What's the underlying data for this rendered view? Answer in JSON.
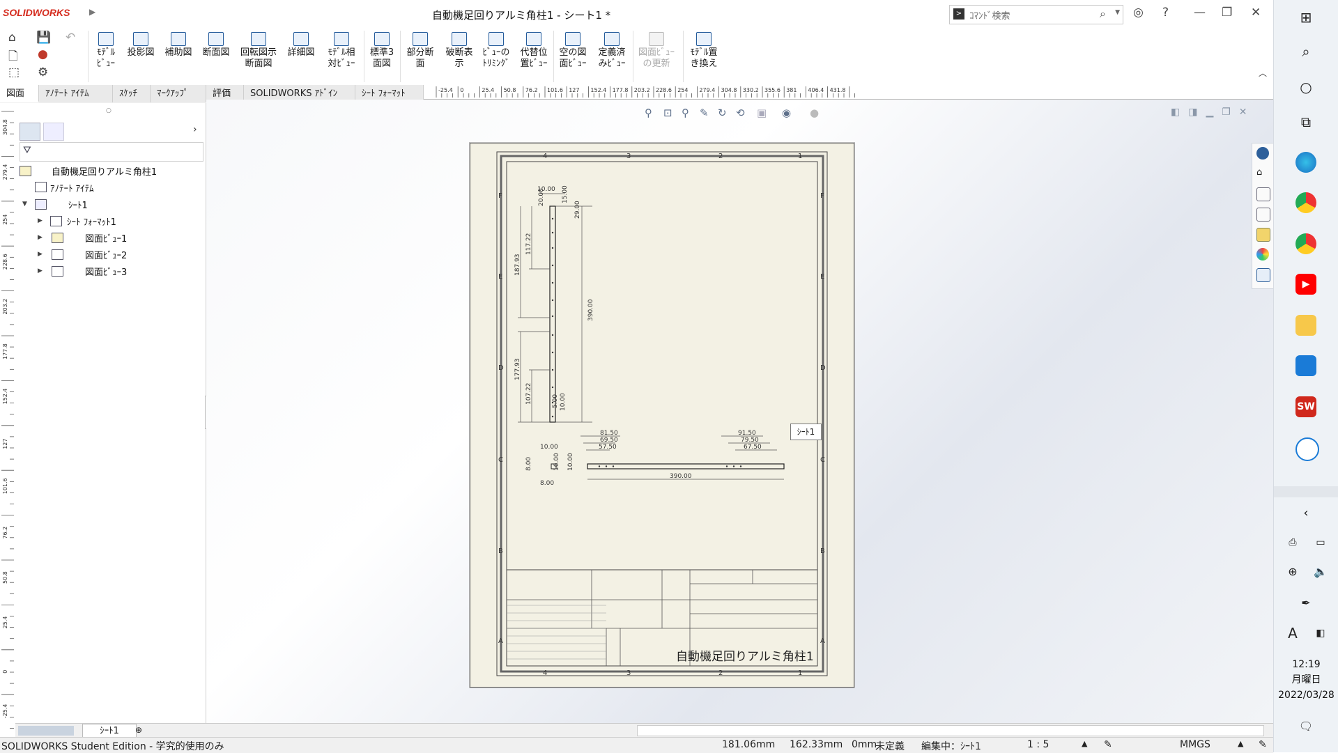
{
  "app": {
    "brand": "SOLIDWORKS",
    "window_title": "自動機足回りアルミ角柱1 - シート1 *"
  },
  "search": {
    "placeholder": "ｺﾏﾝﾄﾞ検索"
  },
  "ribbon": {
    "buttons": [
      "ﾓﾃﾞﾙ\nﾋﾞｭｰ",
      "投影図",
      "補助図",
      "断面図",
      "回転図示\n断面図",
      "詳細図",
      "ﾓﾃﾞﾙ相\n対ﾋﾞｭｰ",
      "標準3\n面図",
      "部分断\n面",
      "破断表\n示",
      "ﾋﾞｭｰの\nﾄﾘﾐﾝｸﾞ",
      "代替位\n置ﾋﾞｭｰ",
      "空の図\n面ﾋﾞｭｰ",
      "定義済\nみﾋﾞｭｰ",
      "図面ﾋﾞｭｰ\nの更新",
      "ﾓﾃﾞﾙ置\nき換え"
    ]
  },
  "tabs": [
    "図面",
    "ｱﾉﾃｰﾄ ｱｲﾃﾑ",
    "ｽｹｯﾁ",
    "ﾏｰｸｱｯﾌﾟ",
    "評価",
    "SOLIDWORKS ｱﾄﾞｲﾝ",
    "ｼｰﾄ ﾌｫｰﾏｯﾄ"
  ],
  "ruler_top": [
    "-25.4",
    "0",
    "25.4",
    "50.8",
    "76.2",
    "101.6",
    "127",
    "152.4",
    "177.8",
    "203.2",
    "228.6",
    "254",
    "279.4",
    "304.8",
    "330.2",
    "355.6",
    "381",
    "406.4",
    "431.8"
  ],
  "ruler_left": [
    "304.8",
    "279.4",
    "254",
    "228.6",
    "203.2",
    "177.8",
    "152.4",
    "127",
    "101.6",
    "76.2",
    "50.8",
    "25.4",
    "0",
    "-25.4"
  ],
  "tree": {
    "root": "自動機足回りアルミ角柱1",
    "annotations": "ｱﾉﾃｰﾄ ｱｲﾃﾑ",
    "sheet": "ｼｰﾄ1",
    "children": [
      "ｼｰﾄ ﾌｫｰﾏｯﾄ1",
      "図面ﾋﾞｭｰ1",
      "図面ﾋﾞｭｰ2",
      "図面ﾋﾞｭｰ3"
    ]
  },
  "drawing": {
    "zones_top": [
      "4",
      "3",
      "2",
      "1"
    ],
    "zones_side": [
      "F",
      "E",
      "D",
      "C",
      "B",
      "A"
    ],
    "dims": {
      "v_left": [
        "10.00",
        "20.00",
        "15.00",
        "29.00",
        "117.22",
        "187.93",
        "390.00",
        "177.93",
        "107.22",
        "5.00",
        "10.00"
      ],
      "h_top": [
        "81.50",
        "69.50",
        "57.50",
        "91.50",
        "79.50",
        "67.50"
      ],
      "small": [
        "10.00",
        "8.00",
        "10.00",
        "10.00",
        "8.00"
      ],
      "length": "390.00"
    },
    "title_block_name": "自動機足回りアルミ角柱1",
    "tooltip": "ｼｰﾄ1"
  },
  "sheet_tab": "ｼｰﾄ1",
  "status": {
    "edition": "SOLIDWORKS Student Edition - 学究的使用のみ",
    "x": "181.06mm",
    "y": "162.33mm",
    "z": "0mm",
    "defined": "未定義",
    "editing": "編集中：ｼｰﾄ1",
    "scale": "1 : 5",
    "units": "MMGS"
  },
  "taskbar": {
    "time": "12:19",
    "weekday": "月曜日",
    "date": "2022/03/28",
    "ime": "A"
  },
  "colors": {
    "brand_red": "#d52b1e",
    "sheet_paper": "#f3f1e4",
    "accent_blue": "#245b9b"
  }
}
